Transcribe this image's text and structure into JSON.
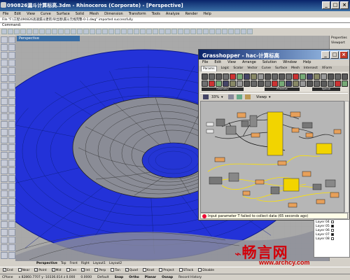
{
  "rhino": {
    "title": "090826漏斗计算标高.3dm - Rhinoceros (Corporate) - [Perspective]",
    "menu": [
      "File",
      "Edit",
      "View",
      "Curve",
      "Surface",
      "Solid",
      "Mesh",
      "Dimension",
      "Transform",
      "Tools",
      "Analyze",
      "Render",
      "Help"
    ],
    "history": "File \"F:\\工程\\090826高速漏斗建筑\\导出图\\漏斗元线完整-0-1.dwg\" imported successfully",
    "command_label": "Command:",
    "viewport_label": "Perspective",
    "properties": {
      "title": "Properties",
      "viewport_label": "Viewport"
    },
    "viewport_tabs": [
      "Perspective",
      "Top",
      "Front",
      "Right",
      "Layout1",
      "Layout2"
    ],
    "active_viewport_tab": "Perspective",
    "osnaps": [
      {
        "label": "End",
        "on": true
      },
      {
        "label": "Near",
        "on": false
      },
      {
        "label": "Point",
        "on": true
      },
      {
        "label": "Mid",
        "on": true
      },
      {
        "label": "Cen",
        "on": false
      },
      {
        "label": "Int",
        "on": true
      },
      {
        "label": "Perp",
        "on": false
      },
      {
        "label": "Tan",
        "on": false
      },
      {
        "label": "Quad",
        "on": true
      },
      {
        "label": "Knot",
        "on": false
      },
      {
        "label": "Project",
        "on": false
      },
      {
        "label": "STrack",
        "on": false
      },
      {
        "label": "Disable",
        "on": false
      }
    ],
    "status": {
      "cplane": "CPlane",
      "coords": "x 82860.7707 y -10336.014 z 0.000",
      "units": "0.0000",
      "layer": "Default",
      "snap": "Snap",
      "ortho": "Ortho",
      "planar": "Planar",
      "osnap": "Osnap",
      "record": "Record History"
    },
    "layers": [
      {
        "name": "Layer 04",
        "color": "#ffffff"
      },
      {
        "name": "Layer 05",
        "color": "#000000"
      },
      {
        "name": "Layer 06",
        "color": "#ffffff"
      },
      {
        "name": "Layer 07",
        "color": "#000000"
      },
      {
        "name": "Layer 08",
        "color": "#ffffff"
      }
    ]
  },
  "grasshopper": {
    "title": "Grasshopper - hac-计算标高",
    "menu": [
      "File",
      "Edit",
      "View",
      "Arrange",
      "Solution",
      "Window",
      "Help"
    ],
    "tabs": [
      "Params",
      "Logic",
      "Scalar",
      "Vector",
      "Curve",
      "Surface",
      "Mesh",
      "Intersect",
      "XForm"
    ],
    "active_tab": "Params",
    "groups": [
      "Geometry",
      "Primitive",
      "Special"
    ],
    "zoom": "33%",
    "viewport_menu": "Viewp",
    "status": "Input parameter T failed to collect data (65 seconds ago)"
  },
  "watermark": {
    "logo": "畅言网",
    "url": "www.archcy.com"
  },
  "colors": {
    "surface_blue": "#2332d8",
    "gh_component": "#f2d400",
    "gh_wire_yellow": "#ffe200",
    "title_blue": "#0a246a"
  }
}
